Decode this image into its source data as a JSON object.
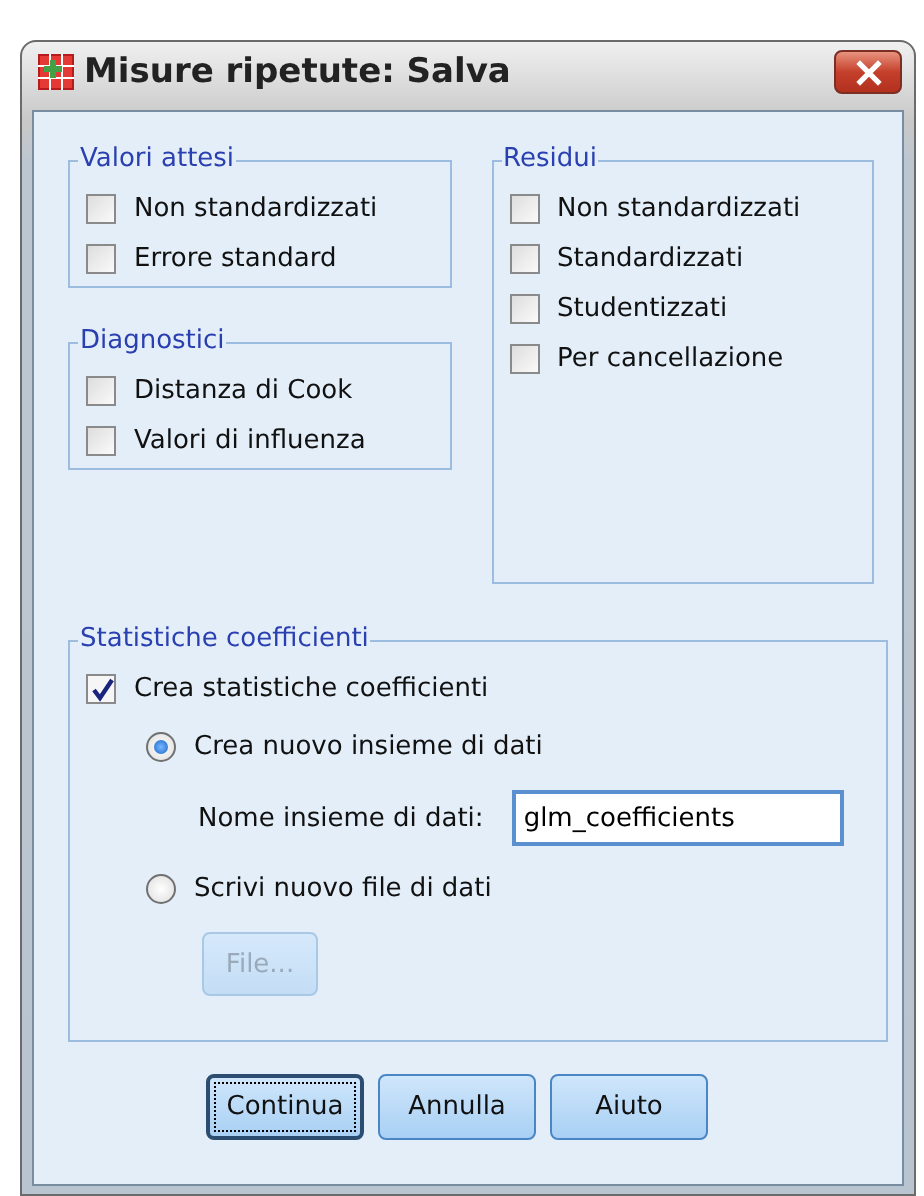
{
  "window": {
    "title": "Misure ripetute: Salva"
  },
  "columns": [
    [
      {
        "title": "Valori attesi",
        "items": [
          {
            "label": "Non standardizzati",
            "checked": false
          },
          {
            "label": "Errore standard",
            "checked": false
          }
        ]
      },
      {
        "title": "Diagnostici",
        "items": [
          {
            "label": "Distanza di Cook",
            "checked": false
          },
          {
            "label": "Valori di influenza",
            "checked": false
          }
        ]
      }
    ],
    [
      {
        "title": "Residui",
        "items": [
          {
            "label": "Non standardizzati",
            "checked": false
          },
          {
            "label": "Standardizzati",
            "checked": false
          },
          {
            "label": "Studentizzati",
            "checked": false
          },
          {
            "label": "Per cancellazione",
            "checked": false
          }
        ]
      }
    ]
  ],
  "coefficients": {
    "title": "Statistiche coefficienti",
    "checkbox": {
      "label": "Crea statistiche coefficienti",
      "checked": true
    },
    "radios": [
      {
        "label": "Crea nuovo insieme di dati",
        "selected": true
      },
      {
        "label": "Scrivi nuovo file di dati",
        "selected": false
      }
    ],
    "dataset_field": {
      "label": "Nome insieme di dati:",
      "value": "glm_coefficients"
    },
    "file_button": {
      "label": "File...",
      "disabled": true
    }
  },
  "buttons": [
    {
      "label": "Continua",
      "default": true
    },
    {
      "label": "Annulla",
      "default": false
    },
    {
      "label": "Aiuto",
      "default": false
    }
  ]
}
